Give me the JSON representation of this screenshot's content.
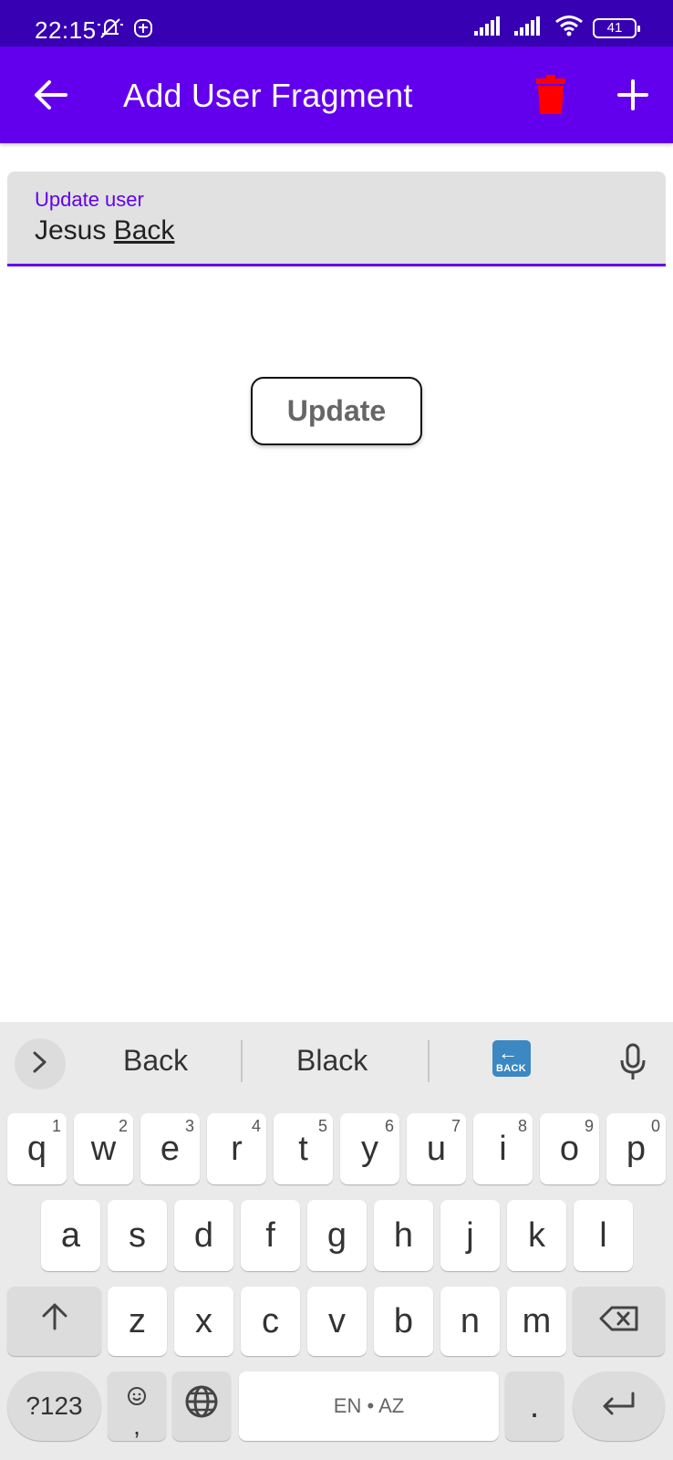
{
  "status": {
    "time": "22:15",
    "battery": "41"
  },
  "app_bar": {
    "title": "Add User Fragment"
  },
  "text_field": {
    "label": "Update user",
    "value_first": "Jesus",
    "value_second": "Back"
  },
  "update_button": {
    "label": "Update"
  },
  "keyboard": {
    "suggestions": [
      "Back",
      "Black"
    ],
    "emoji_label": "BACK",
    "row1": [
      {
        "key": "q",
        "hint": "1"
      },
      {
        "key": "w",
        "hint": "2"
      },
      {
        "key": "e",
        "hint": "3"
      },
      {
        "key": "r",
        "hint": "4"
      },
      {
        "key": "t",
        "hint": "5"
      },
      {
        "key": "y",
        "hint": "6"
      },
      {
        "key": "u",
        "hint": "7"
      },
      {
        "key": "i",
        "hint": "8"
      },
      {
        "key": "o",
        "hint": "9"
      },
      {
        "key": "p",
        "hint": "0"
      }
    ],
    "row2": [
      "a",
      "s",
      "d",
      "f",
      "g",
      "h",
      "j",
      "k",
      "l"
    ],
    "row3": [
      "z",
      "x",
      "c",
      "v",
      "b",
      "n",
      "m"
    ],
    "symbols_label": "?123",
    "comma_label": ",",
    "space_label": "EN • AZ",
    "period_label": "."
  },
  "colors": {
    "primary": "#6200ee",
    "primary_dark": "#3700b3",
    "delete_icon": "#ff0000"
  }
}
